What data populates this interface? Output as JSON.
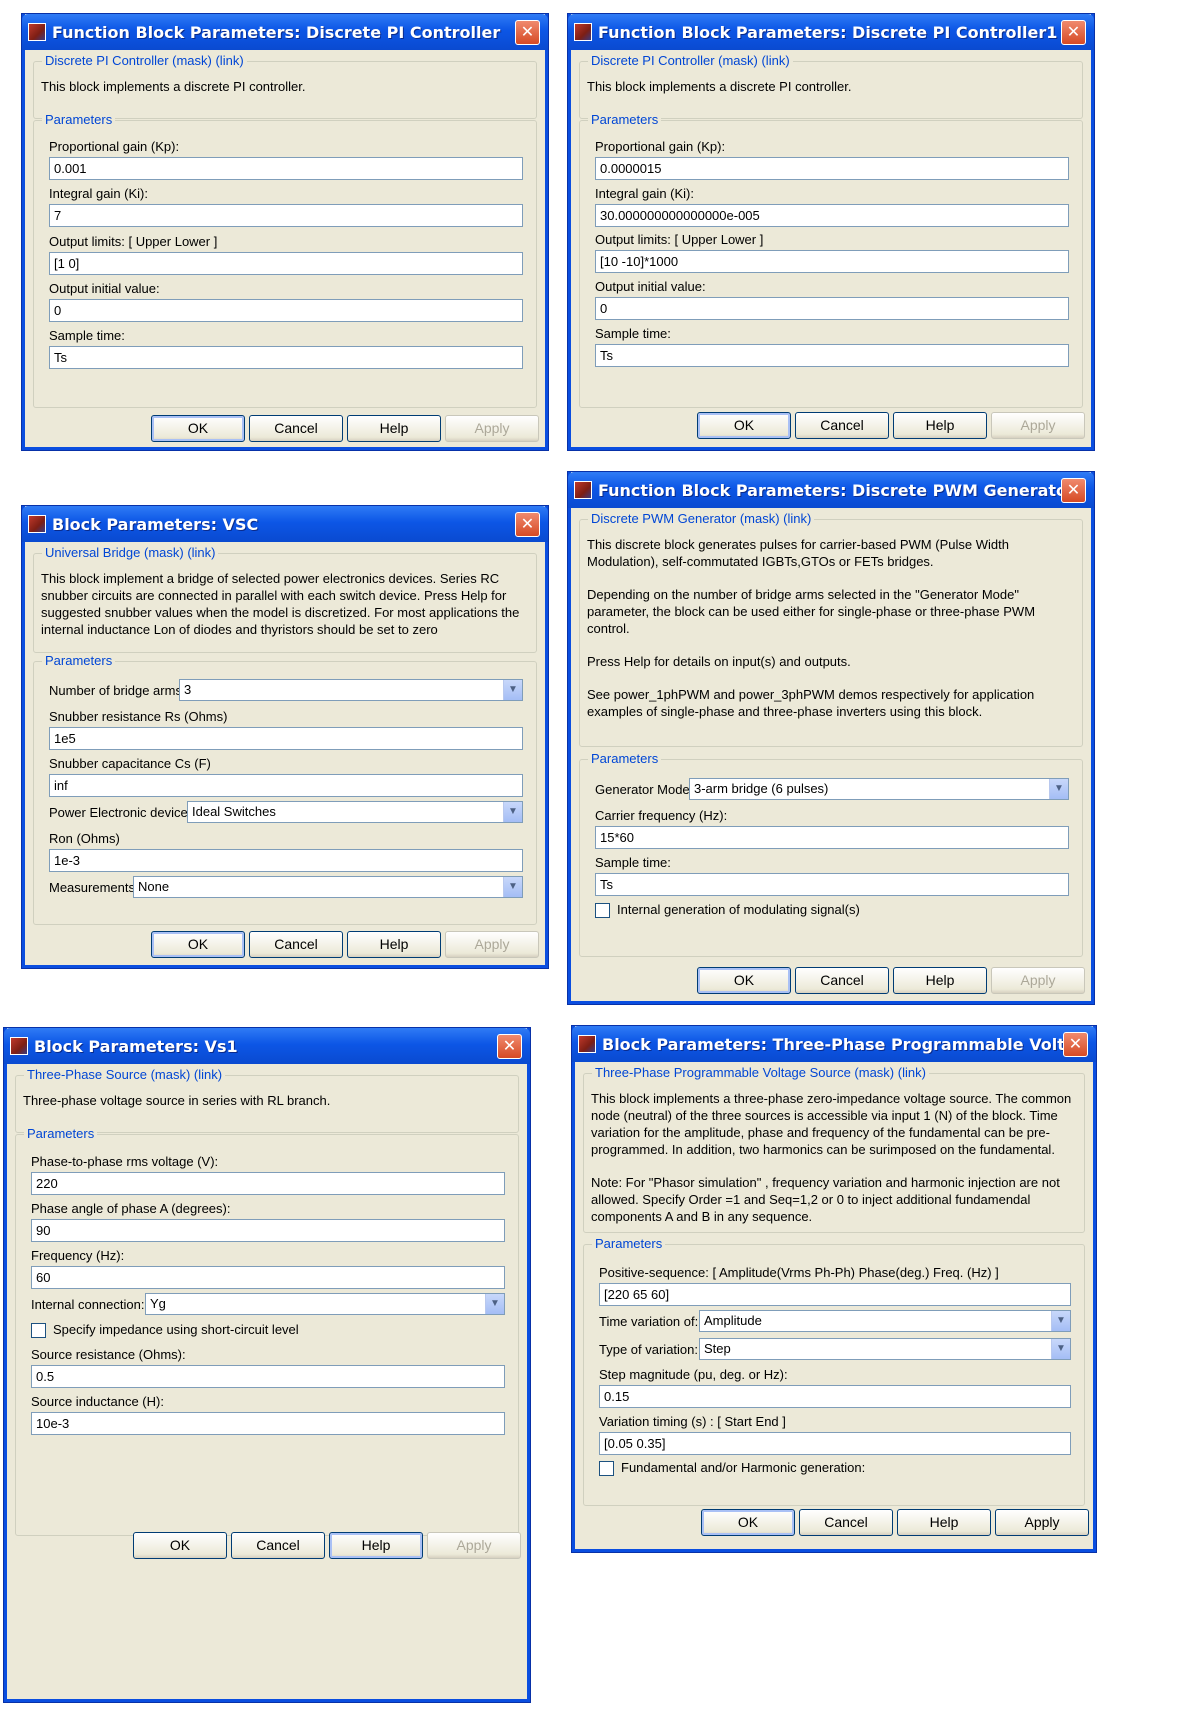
{
  "colors": {
    "title_bar": "#0c56e6",
    "dialog_bg": "#ece9d8",
    "group_label": "#0046d5",
    "close_button": "#d64a25"
  },
  "icons": {
    "app": "block-parameters-icon",
    "close": "close-icon",
    "dropdown": "chevron-down-icon"
  },
  "dialog1": {
    "title": "Function Block Parameters: Discrete PI Controller",
    "close": "✕",
    "group_label": "Discrete PI Controller (mask) (link)",
    "description": "This block implements a discrete PI controller.",
    "params_label": "Parameters",
    "kp_label": "Proportional gain (Kp):",
    "kp_value": "0.001",
    "ki_label": "Integral gain (Ki):",
    "ki_value": "7",
    "limits_label": "Output limits: [ Upper   Lower ]",
    "limits_value": "[1 0]",
    "init_label": "Output initial value:",
    "init_value": "0",
    "sample_label": "Sample time:",
    "sample_value": "Ts",
    "ok": "OK",
    "cancel": "Cancel",
    "help": "Help",
    "apply": "Apply"
  },
  "dialog2": {
    "title": "Function Block Parameters: Discrete PI Controller1",
    "close": "✕",
    "group_label": "Discrete PI Controller (mask) (link)",
    "description": "This block implements a discrete PI controller.",
    "params_label": "Parameters",
    "kp_label": "Proportional gain (Kp):",
    "kp_value": "0.0000015",
    "ki_label": "Integral gain (Ki):",
    "ki_value": "30.000000000000000e-005",
    "limits_label": "Output limits: [ Upper   Lower ]",
    "limits_value": "[10 -10]*1000",
    "init_label": "Output initial value:",
    "init_value": "0",
    "sample_label": "Sample time:",
    "sample_value": "Ts",
    "ok": "OK",
    "cancel": "Cancel",
    "help": "Help",
    "apply": "Apply"
  },
  "dialog3": {
    "title": "Block Parameters:  VSC",
    "close": "✕",
    "group_label": "Universal Bridge (mask) (link)",
    "description": "This block implement a bridge of selected power electronics devices.  Series RC snubber circuits are connected in parallel with each switch device.  Press Help for suggested snubber values when the model is discretized. For most applications the internal inductance Lon of diodes and thyristors should be set to zero",
    "params_label": "Parameters",
    "arms_label": "Number of bridge arms:",
    "arms_value": "3",
    "rs_label": "Snubber resistance Rs (Ohms)",
    "rs_value": "1e5",
    "cs_label": "Snubber capacitance Cs (F)",
    "cs_value": "inf",
    "device_label": "Power Electronic device",
    "device_value": "Ideal Switches",
    "ron_label": "Ron (Ohms)",
    "ron_value": "1e-3",
    "meas_label": "Measurements",
    "meas_value": "None",
    "ok": "OK",
    "cancel": "Cancel",
    "help": "Help",
    "apply": "Apply"
  },
  "dialog4": {
    "title": "Function Block Parameters: Discrete PWM Generator",
    "close": "✕",
    "group_label": "Discrete PWM Generator (mask) (link)",
    "desc_p1": "This discrete block generates pulses for carrier-based PWM (Pulse Width Modulation), self-commutated IGBTs,GTOs or FETs bridges.",
    "desc_p2": "Depending on the number of bridge arms selected in the \"Generator Mode\" parameter, the block can be used either for single-phase or three-phase PWM control.",
    "desc_p3": "Press Help for details on input(s) and outputs.",
    "desc_p4": "See power_1phPWM and power_3phPWM demos respectively  for application examples of single-phase and three-phase inverters using this block.",
    "params_label": "Parameters",
    "mode_label": "Generator Mode",
    "mode_value": "3-arm  bridge (6 pulses)",
    "carrier_label": "Carrier frequency (Hz):",
    "carrier_value": "15*60",
    "sample_label": "Sample time:",
    "sample_value": "Ts",
    "internal_label": "Internal generation of modulating signal(s)",
    "ok": "OK",
    "cancel": "Cancel",
    "help": "Help",
    "apply": "Apply"
  },
  "dialog5": {
    "title": "Block Parameters: Vs1",
    "close": "✕",
    "group_label": "Three-Phase Source (mask) (link)",
    "description": "Three-phase voltage source in series with RL branch.",
    "params_label": "Parameters",
    "vrms_label": "Phase-to-phase rms voltage (V):",
    "vrms_value": "220",
    "phase_label": "Phase angle of phase A (degrees):",
    "phase_value": "90",
    "freq_label": "Frequency (Hz):",
    "freq_value": "60",
    "conn_label": "Internal connection:",
    "conn_value": "Yg",
    "impedance_label": "Specify impedance using short-circuit level",
    "res_label": "Source resistance (Ohms):",
    "res_value": "0.5",
    "ind_label": "Source inductance (H):",
    "ind_value": "10e-3",
    "ok": "OK",
    "cancel": "Cancel",
    "help": "Help",
    "apply": "Apply"
  },
  "dialog6": {
    "title": "Block Parameters: Three-Phase Programmable Voltage Source",
    "close": "✕",
    "group_label": "Three-Phase Programmable Voltage Source (mask) (link)",
    "desc_p1": "This block implements a three-phase zero-impedance voltage source. The common node (neutral) of the three sources is accessible via input 1 (N) of the block. Time variation for the amplitude, phase and frequency of the fundamental can be pre-programmed. In addition, two harmonics can be surimposed on the fundamental.",
    "desc_p2": "Note: For  \"Phasor simulation\" , frequency variation and harmonic injection are not allowed.  Specify  Order =1 and Seq=1,2 or 0 to inject additional fundamendal components A and B in  any sequence.",
    "params_label": "Parameters",
    "posseq_label": "Positive-sequence: [ Amplitude(Vrms Ph-Ph)  Phase(deg.)  Freq. (Hz) ]",
    "posseq_value": "[220  65 60]",
    "timevar_label": "Time variation of:",
    "timevar_value": "Amplitude",
    "type_label": "Type of variation:",
    "type_value": "Step",
    "step_label": "Step magnitude (pu, deg. or Hz):",
    "step_value": "0.15",
    "timing_label": "Variation timing (s) : [ Start   End ]",
    "timing_value": "[0.05 0.35]",
    "harmonic_label": "Fundamental and/or Harmonic generation:",
    "ok": "OK",
    "cancel": "Cancel",
    "help": "Help",
    "apply": "Apply"
  }
}
